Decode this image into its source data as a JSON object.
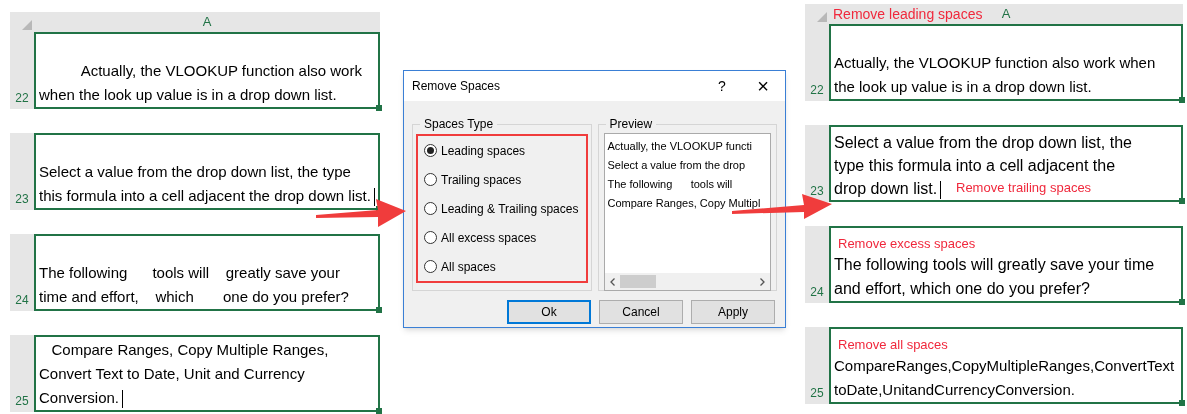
{
  "left_sheet": {
    "column_header": "A",
    "rows": [
      {
        "number": "22",
        "kind": "plain",
        "text": "          Actually, the VLOOKUP function also work when the look up value is in a drop down list.",
        "cursor": false
      },
      {
        "number": "23",
        "kind": "plain",
        "text": "Select a value from the drop down list, the type this formula into a cell adjacent the drop down list.",
        "cursor": true
      },
      {
        "number": "24",
        "kind": "plain",
        "text": "The following      tools will    greatly save your    time and effort,    which       one do you prefer?",
        "cursor": false
      },
      {
        "number": "25",
        "kind": "plain",
        "text": "   Compare Ranges, Copy Multiple Ranges, Convert Text to Date, Unit and Currency Conversion.",
        "cursor": true
      }
    ]
  },
  "dialog": {
    "title": "Remove Spaces",
    "help": "?",
    "close": "×",
    "spaces_type": {
      "label": "Spaces Type",
      "options": [
        {
          "label": "Leading spaces",
          "selected": true
        },
        {
          "label": "Trailing spaces",
          "selected": false
        },
        {
          "label": "Leading & Trailing spaces",
          "selected": false
        },
        {
          "label": "All excess spaces",
          "selected": false
        },
        {
          "label": "All spaces",
          "selected": false
        }
      ]
    },
    "preview": {
      "label": "Preview",
      "lines": [
        "Actually, the VLOOKUP functi",
        "Select a value from the drop",
        "The following      tools will",
        "Compare Ranges, Copy Multipl"
      ]
    },
    "buttons": [
      {
        "label": "Ok",
        "default": true
      },
      {
        "label": "Cancel",
        "default": false
      },
      {
        "label": "Apply",
        "default": false
      }
    ]
  },
  "right_sheet": {
    "header_note": "Remove leading spaces",
    "column_header": "A",
    "rows": [
      {
        "number": "22",
        "kind": "plain",
        "text": "Actually, the VLOOKUP function also work when the look up value is in a drop down list.",
        "cursor": false
      },
      {
        "number": "23",
        "kind": "inline_note",
        "text": "Select a value from the drop down list, the type this formula into a cell adjacent the drop down list.",
        "cursor": true,
        "note": "Remove trailing spaces"
      },
      {
        "number": "24",
        "kind": "note_above",
        "text": "The following tools will greatly save your time and effort, which one do you prefer?",
        "cursor": false,
        "note": "Remove excess spaces"
      },
      {
        "number": "25",
        "kind": "note_above_unbroken",
        "text": "CompareRanges,CopyMultipleRanges,ConvertTexttoDate,UnitandCurrencyConversion.",
        "cursor": false,
        "note": "Remove all spaces"
      }
    ]
  }
}
